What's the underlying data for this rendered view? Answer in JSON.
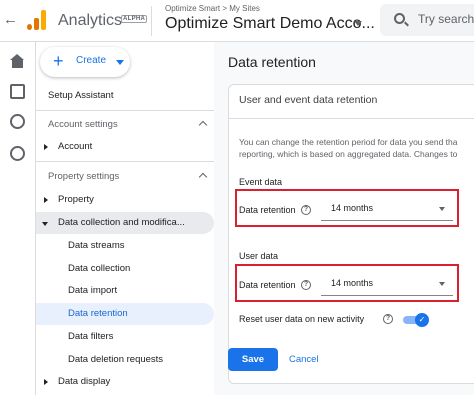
{
  "header": {
    "back_icon": "arrow-back-icon",
    "app_name": "Analytics",
    "badge": "ALPHA",
    "breadcrumb": "Optimize Smart > My Sites",
    "account_name": "Optimize Smart Demo Acco...",
    "search_placeholder": "Try searchin"
  },
  "rail": {
    "icons": [
      "home-icon",
      "reports-icon",
      "explore-icon",
      "advertising-icon"
    ]
  },
  "nav": {
    "create_label": "Create",
    "setup_assistant": "Setup Assistant",
    "account_settings": "Account settings",
    "account": "Account",
    "property_settings": "Property settings",
    "property": "Property",
    "data_collection": "Data collection and modifica...",
    "sub_items": [
      "Data streams",
      "Data collection",
      "Data import",
      "Data retention",
      "Data filters",
      "Data deletion requests"
    ],
    "data_display": "Data display"
  },
  "main": {
    "title": "Data retention",
    "card_title": "User and event data retention",
    "desc_line1": "You can change the retention period for data you send tha",
    "desc_line2": "reporting, which is based on aggregated data. Changes to",
    "event_data": {
      "heading": "Event data",
      "label": "Data retention",
      "value": "14 months"
    },
    "user_data": {
      "heading": "User data",
      "label": "Data retention",
      "value": "14 months"
    },
    "reset_label": "Reset user data on new activity",
    "reset_enabled": true,
    "save_label": "Save",
    "cancel_label": "Cancel"
  },
  "colors": {
    "accent": "#1a73e8",
    "highlight_box": "#d9202f",
    "logo_orange": "#e37400"
  }
}
